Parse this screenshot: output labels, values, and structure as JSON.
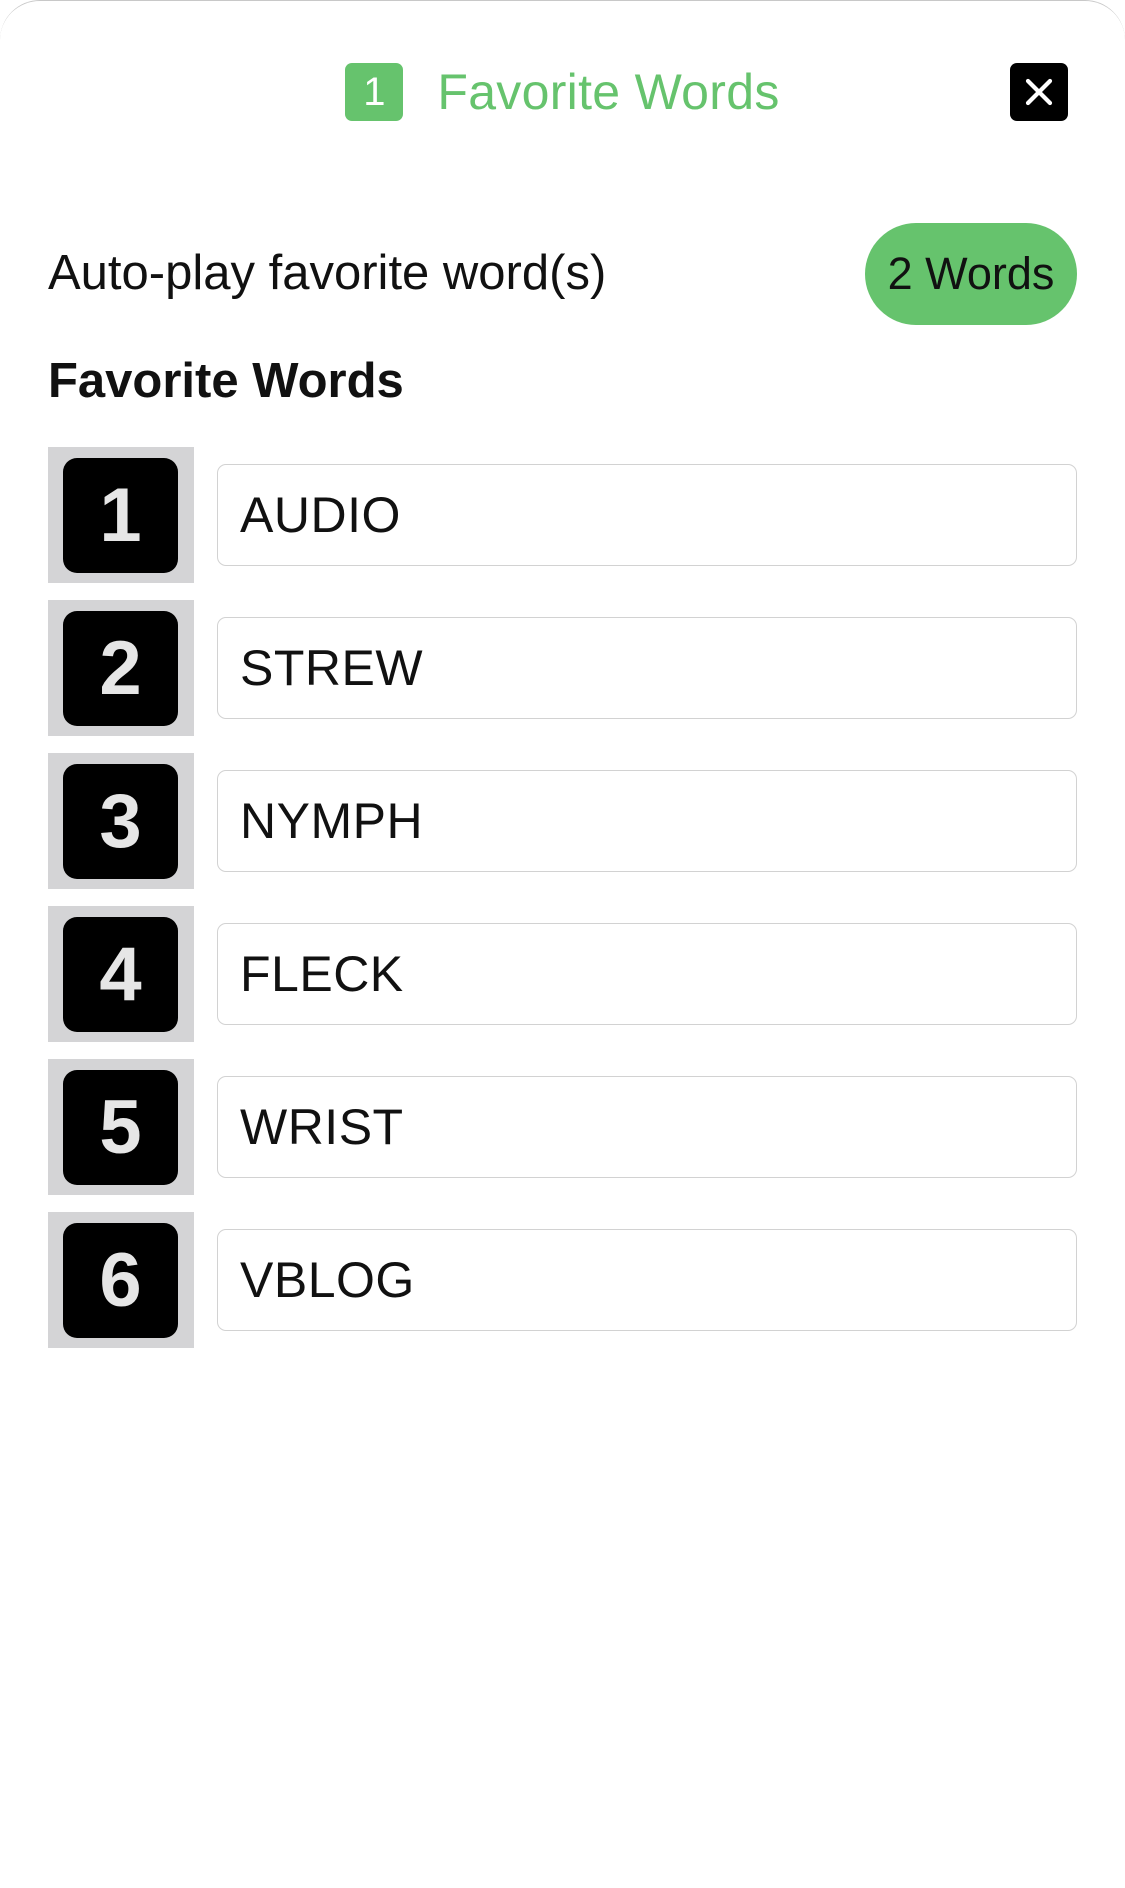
{
  "header": {
    "badge": "1",
    "title": "Favorite Words",
    "close_icon": "close-icon"
  },
  "autoplay": {
    "label": "Auto-play favorite word(s)",
    "pill": "2 Words"
  },
  "section": {
    "title": "Favorite Words"
  },
  "words": [
    {
      "number": "1",
      "word": "AUDIO"
    },
    {
      "number": "2",
      "word": "STREW"
    },
    {
      "number": "3",
      "word": "NYMPH"
    },
    {
      "number": "4",
      "word": "FLECK"
    },
    {
      "number": "5",
      "word": "WRIST"
    },
    {
      "number": "6",
      "word": "VBLOG"
    }
  ],
  "colors": {
    "accent": "#66c36d",
    "tile_bg": "#d4d4d6",
    "key_bg": "#000000"
  }
}
